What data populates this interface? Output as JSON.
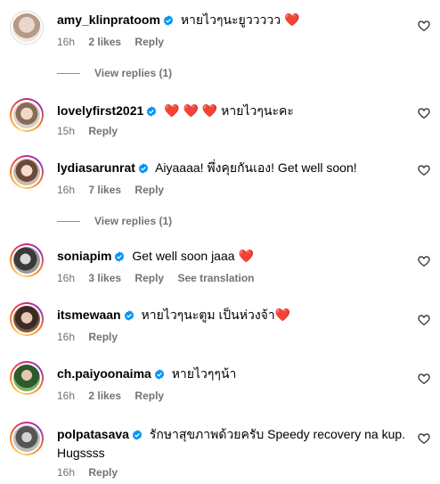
{
  "comments": [
    {
      "user": "amy_klinpratoom",
      "text": "หายไวๆนะยูววววว",
      "heart": "❤️",
      "time": "16h",
      "likes": "2 likes",
      "reply": "Reply",
      "replies": "View replies (1)"
    },
    {
      "user": "lovelyfirst2021",
      "hearts": "❤️ ❤️ ❤️",
      "text": "หายไวๆนะคะ",
      "time": "15h",
      "reply": "Reply"
    },
    {
      "user": "lydiasarunrat",
      "text": "Aiyaaaa! พึ่งคุยกันเอง! Get well soon!",
      "time": "16h",
      "likes": "7 likes",
      "reply": "Reply",
      "replies": "View replies (1)"
    },
    {
      "user": "soniapim",
      "text": "Get well soon jaaa",
      "heart": "❤️",
      "time": "16h",
      "likes": "3 likes",
      "reply": "Reply",
      "translate": "See translation"
    },
    {
      "user": "itsmewaan",
      "text": "หายไวๆนะตูม เป็นห่วงจ้า",
      "heart": "❤️",
      "time": "16h",
      "reply": "Reply"
    },
    {
      "user": "ch.paiyoonaima",
      "text": "หายไวๆๆน้า",
      "time": "16h",
      "likes": "2 likes",
      "reply": "Reply"
    },
    {
      "user": "polpatasava",
      "text": "รักษาสุขภาพด้วยครับ Speedy recovery na kup. Hugssss",
      "time": "16h",
      "reply": "Reply"
    }
  ],
  "colors": {
    "verified": "#0095f6",
    "heart": "#e41e52",
    "muted": "#737373"
  }
}
